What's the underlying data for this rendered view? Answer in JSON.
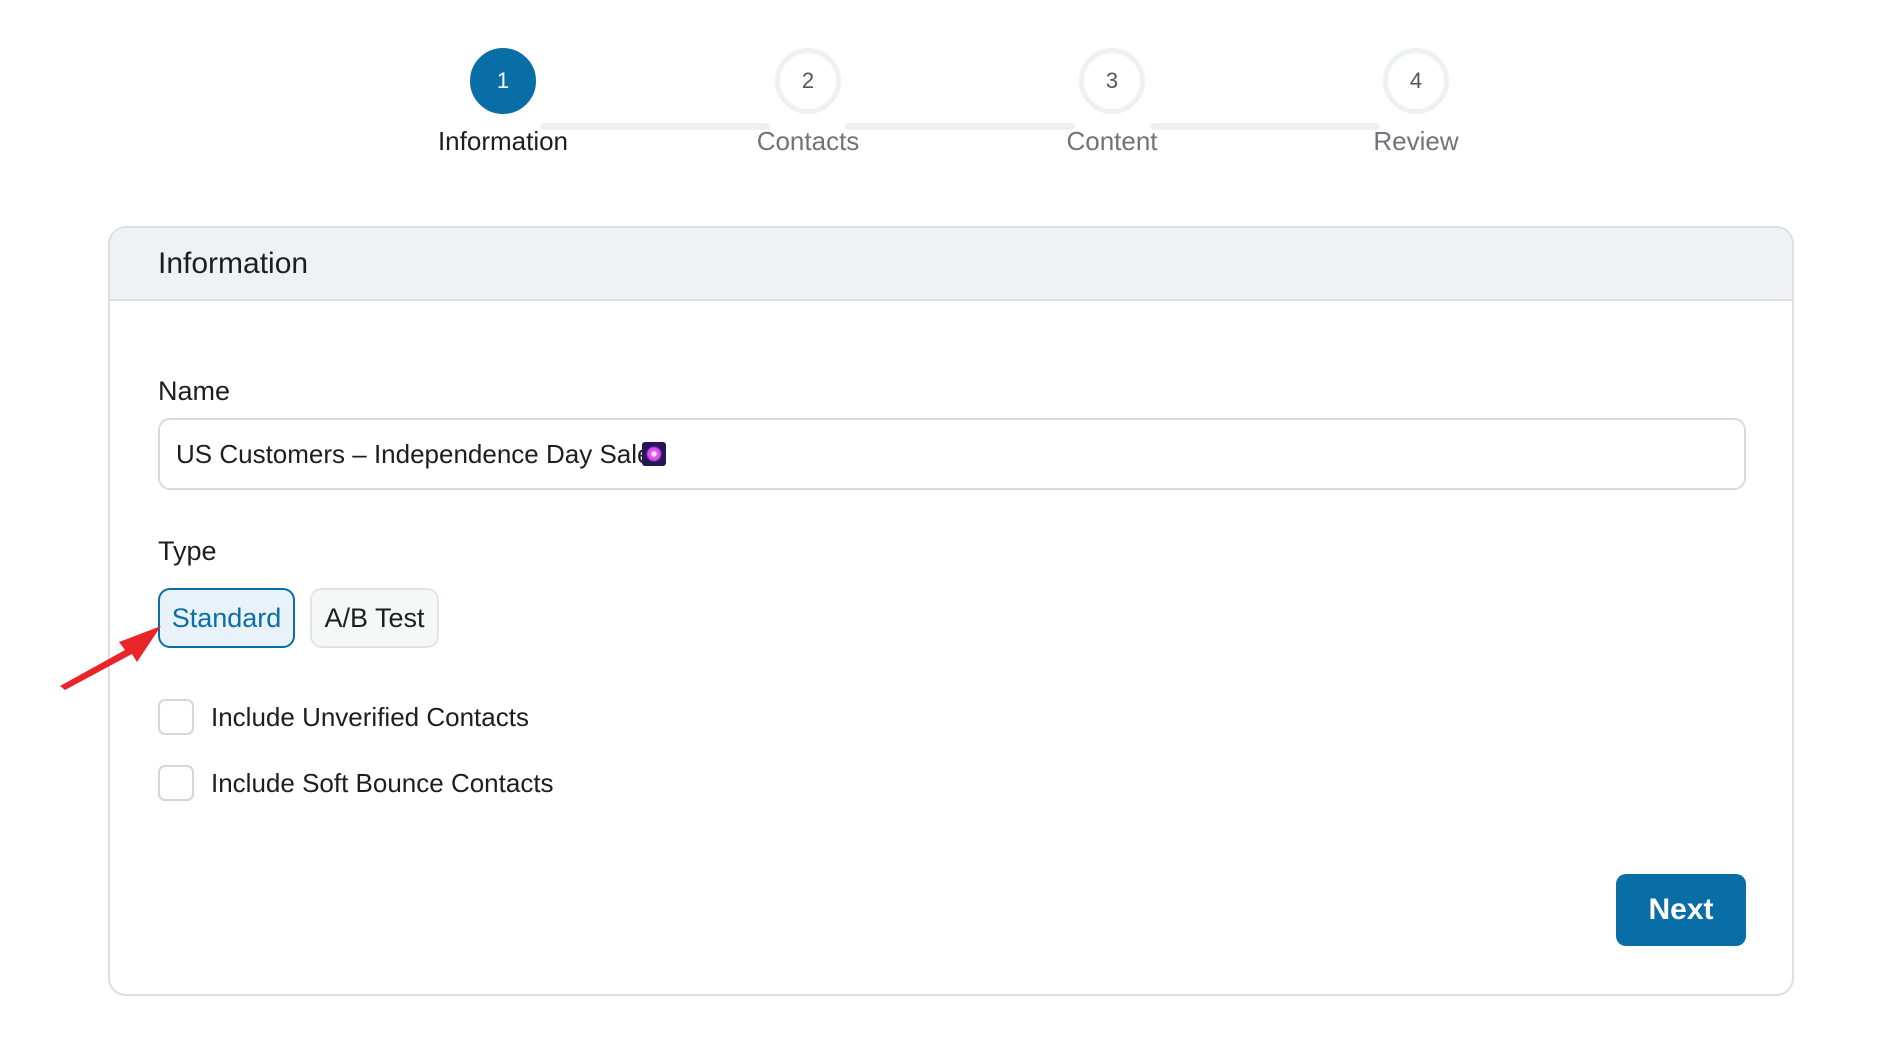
{
  "stepper": {
    "steps": [
      {
        "number": "1",
        "label": "Information",
        "active": true
      },
      {
        "number": "2",
        "label": "Contacts",
        "active": false
      },
      {
        "number": "3",
        "label": "Content",
        "active": false
      },
      {
        "number": "4",
        "label": "Review",
        "active": false
      }
    ]
  },
  "card": {
    "title": "Information",
    "name_label": "Name",
    "name_value": "US Customers – Independence Day Sale",
    "name_emoji_icon": "fireworks-emoji-icon",
    "type_label": "Type",
    "type_options": [
      {
        "label": "Standard",
        "selected": true
      },
      {
        "label": "A/B Test",
        "selected": false
      }
    ],
    "checkboxes": [
      {
        "label": "Include Unverified Contacts",
        "checked": false
      },
      {
        "label": "Include Soft Bounce Contacts",
        "checked": false
      }
    ],
    "next_label": "Next"
  },
  "annotation": {
    "type": "red-arrow-icon",
    "color": "#e8262a"
  },
  "colors": {
    "accent": "#0a6ea6",
    "header_bg": "#f0f1f5",
    "border": "#dcdee3"
  }
}
